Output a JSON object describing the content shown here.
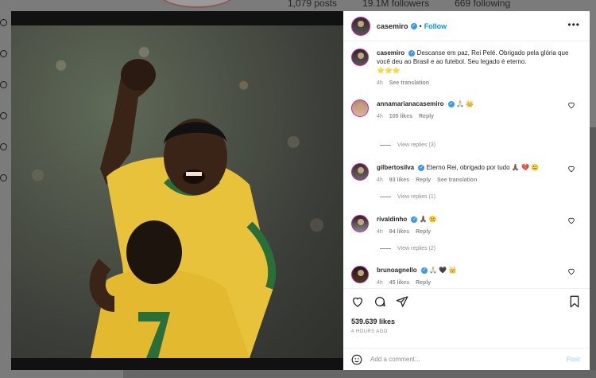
{
  "background": {
    "stats": {
      "posts": "1,079 posts",
      "followers": "19.1M followers",
      "following": "669 following"
    }
  },
  "post": {
    "username": "casemiro",
    "follow_label": "Follow",
    "separator": "•",
    "more_icon": "more-options-icon",
    "caption": "Descanse em paz, Rei Pelé. Obrigado pela glória que você deu ao Brasil e ao futebol. Seu legado é eterno.",
    "caption_emoji": "⭐⭐⭐",
    "caption_time": "4h",
    "see_translation": "See translation",
    "likes": "539.639 likes",
    "time_ago": "4 HOURS AGO",
    "add_comment_placeholder": "Add a comment...",
    "post_label": "Post"
  },
  "comments": [
    {
      "user": "annamarianacasemiro",
      "text": "🙏🏻 👑",
      "time": "4h",
      "likes": "105 likes",
      "reply": "Reply",
      "view_replies": "View replies (3)"
    },
    {
      "user": "gilbertosilva",
      "text": "Eterno Rei, obrigado por tudo 🙏🏾 💔 ☹️",
      "time": "4h",
      "likes": "93 likes",
      "reply": "Reply",
      "see_translation": "See translation",
      "view_replies": "View replies (1)"
    },
    {
      "user": "rivaldinho",
      "text": "🙏🏾 ☹️",
      "time": "4h",
      "likes": "94 likes",
      "reply": "Reply",
      "view_replies": "View replies (2)"
    },
    {
      "user": "brunoagnello",
      "text": "🙏🏻 🖤 👑",
      "time": "4h",
      "likes": "45 likes",
      "reply": "Reply"
    }
  ],
  "photo": {
    "jersey_number": "7"
  },
  "colors": {
    "link": "#0095f6",
    "verified": "#3897f0",
    "text": "#262626",
    "muted": "#8e8e8e"
  }
}
